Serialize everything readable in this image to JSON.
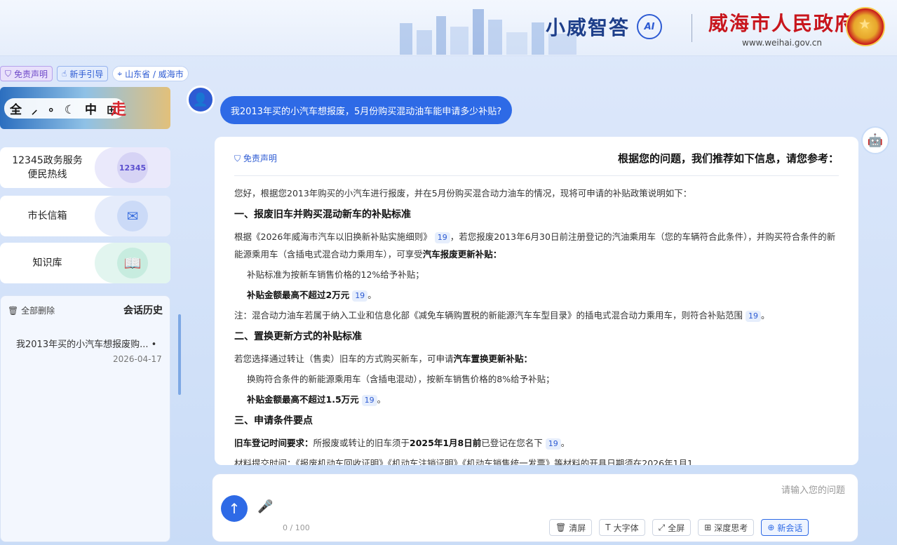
{
  "header": {
    "assistant_name": "小威智答",
    "ai_badge": "AI",
    "gov_name": "威海市人民政府",
    "gov_url": "www.weihai.gov.cn"
  },
  "topbar": {
    "disclaimer": "免责声明",
    "guide": "新手引导",
    "location": "山东省 / 威海市"
  },
  "banner": {
    "text": "全 ⸝ ∘ ☾ 中 ⊞",
    "accent": "走"
  },
  "sidebar": {
    "items": [
      {
        "label": "12345政务服务\n便民热线",
        "icon": "12345-logo-icon",
        "icon_text": "12345"
      },
      {
        "label": "市长信箱",
        "icon": "mail-icon",
        "icon_text": "✉"
      },
      {
        "label": "知识库",
        "icon": "book-icon",
        "icon_text": "📖"
      }
    ],
    "history": {
      "title": "会话历史",
      "clear": "全部删除",
      "items": [
        {
          "text": "我2013年买的小汽车想报废购...",
          "date": "2026-04-17"
        }
      ]
    }
  },
  "chat": {
    "user_message": "我2013年买的小汽车想报废，5月份购买混动油车能申请多少补贴?",
    "answer": {
      "title": "根据您的问题，我们推荐如下信息，请您参考：",
      "disclaimer": "免责声明",
      "intro": "您好，根据您2013年购买的小汽车进行报废，并在5月份购买混合动力油车的情况，现将可申请的补贴政策说明如下：",
      "s1_title": "一、报废旧车并购买混动新车的补贴标准",
      "s1_p1a": "根据《2026年威海市汽车以旧换新补贴实施细则》",
      "s1_p1b": "，若您报废2013年6月30日前注册登记的汽油乘用车（您的车辆符合此条件），并购买符合条件的新能源乘用车（含插电式混合动力乘用车），可享受",
      "s1_p1c": "汽车报废更新补贴：",
      "s1_li1": "补贴标准为按新车销售价格的12%给予补贴；",
      "s1_li2": "补贴金额最高不超过2万元",
      "s1_note": "注：混合动力油车若属于纳入工业和信息化部《减免车辆购置税的新能源汽车车型目录》的插电式混合动力乘用车，则符合补贴范围",
      "s2_title": "二、置换更新方式的补贴标准",
      "s2_p1a": "若您选择通过转让（售卖）旧车的方式购买新车，可申请",
      "s2_p1b": "汽车置换更新补贴：",
      "s2_li1": "换购符合条件的新能源乘用车（含插电混动），按新车销售价格的8%给予补贴；",
      "s2_li2": "补贴金额最高不超过1.5万元",
      "s3_title": "三、申请条件要点",
      "s3_p1a": "旧车登记时间要求：",
      "s3_p1b": "所报废或转让的旧车须于",
      "s3_p1c": "2025年1月8日前",
      "s3_p1d": "已登记在您名下",
      "s3_p2": "材料提交时间：《报废机动车回收证明》《机动车注销证明》《机动车销售统一发票》等材料的开具日期须在2026年1月1",
      "ref": "19"
    }
  },
  "input": {
    "placeholder": "请输入您的问题",
    "counter": "0 / 100",
    "tools": [
      "新会话",
      "深度思考",
      "全屏",
      "大字体",
      "清屏"
    ]
  }
}
